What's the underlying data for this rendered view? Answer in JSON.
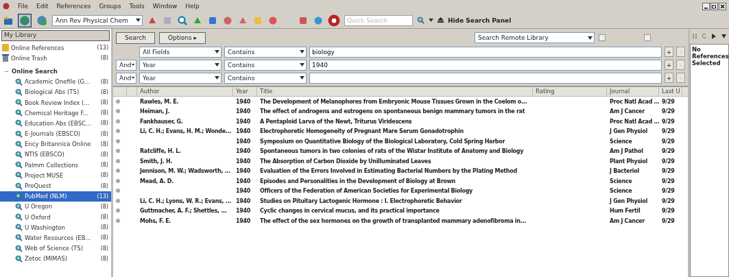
{
  "menu": [
    "File",
    "Edit",
    "References",
    "Groups",
    "Tools",
    "Window",
    "Help"
  ],
  "toolbar": {
    "style": "Ann Rev Physical Chem",
    "quick_search": {
      "placeholder": "Quick Search"
    },
    "hide_panel": "Hide Search Panel"
  },
  "sidebar": {
    "header": "My Library",
    "top_items": [
      {
        "kind": "references",
        "label": "Online References",
        "count": "(13)",
        "selected": false
      },
      {
        "kind": "trash",
        "label": "Online Trash",
        "count": "(8)",
        "selected": false
      }
    ],
    "group": {
      "toggle": "−",
      "label": "Online Search",
      "items": [
        {
          "label": "Academic Onefile (G...",
          "count": "(8)",
          "selected": false
        },
        {
          "label": "Biological Abs (TS)",
          "count": "(8)",
          "selected": false
        },
        {
          "label": "Book Review Index (...",
          "count": "(8)",
          "selected": false
        },
        {
          "label": "Chemical Heritage F...",
          "count": "(8)",
          "selected": false
        },
        {
          "label": "Education Abs (EBSC...",
          "count": "(8)",
          "selected": false
        },
        {
          "label": "E-Journals (EBSCO)",
          "count": "(8)",
          "selected": false
        },
        {
          "label": "Ency Britannica Online",
          "count": "(8)",
          "selected": false
        },
        {
          "label": "NTIS (EBSCO)",
          "count": "(8)",
          "selected": false
        },
        {
          "label": "Palmm Collections",
          "count": "(8)",
          "selected": false
        },
        {
          "label": "Project MUSE",
          "count": "(8)",
          "selected": false
        },
        {
          "label": "ProQuest",
          "count": "(8)",
          "selected": false
        },
        {
          "label": "PubMed (NLM)",
          "count": "(13)",
          "selected": true
        },
        {
          "label": "U Oregon",
          "count": "(8)",
          "selected": false
        },
        {
          "label": "U Oxford",
          "count": "(8)",
          "selected": false
        },
        {
          "label": "U Washington",
          "count": "(8)",
          "selected": false
        },
        {
          "label": "Water Resources (EB...",
          "count": "(8)",
          "selected": false
        },
        {
          "label": "Web of Science (TS)",
          "count": "(8)",
          "selected": false
        },
        {
          "label": "Zetoc (MIMAS)",
          "count": "(8)",
          "selected": false
        }
      ]
    }
  },
  "search_panel": {
    "search_button": "Search",
    "options_button": "Options ▸",
    "mode": "Search Remote Library",
    "remote_options": [
      {
        "checked": false
      },
      {
        "checked": false
      }
    ],
    "criteria": [
      {
        "field": "All Fields",
        "operator": "Contains",
        "value": "biology",
        "add": "+",
        "remove": "-"
      },
      {
        "connector": "And",
        "field": "Year",
        "operator": "Contains",
        "value": "1940",
        "add": "+",
        "remove": "-"
      },
      {
        "connector": "And",
        "field": "Year",
        "operator": "Contains",
        "add": "+",
        "remove": "-"
      }
    ]
  },
  "table": {
    "columns": [
      "Author",
      "Year",
      "Title",
      "Rating",
      "Journal",
      "Last U"
    ],
    "rows": [
      {
        "author": "Rawles, M. E.",
        "year": "1940",
        "title": "The Development of Melanophores from Embryonic Mouse Tissues Grown in the Coelom o...",
        "journal": "Proc Natl Acad ...",
        "last": "9/29"
      },
      {
        "author": "Heiman, J.",
        "year": "1940",
        "title": "The effect of androgens and estrogens on spontaneous benign mammary tumors in the rat",
        "journal": "Am J Cancer",
        "last": "9/29"
      },
      {
        "author": "Fankhauser, G.",
        "year": "1940",
        "title": "A Pentaploid Larva of the Newt, Triturus Viridescens",
        "journal": "Proc Natl Acad ...",
        "last": "9/29"
      },
      {
        "author": "Li, C. H.; Evans, H. M.; Wonde...",
        "year": "1940",
        "title": "Electrophoretic Homogeneity of Pregnant Mare Serum Gonadotrophin",
        "journal": "J Gen Physiol",
        "last": "9/29"
      },
      {
        "author": "",
        "year": "1940",
        "title": "Symposium on Quantitative Biology of the Biological Laboratory, Cold Spring Harbor",
        "journal": "Science",
        "last": "9/29"
      },
      {
        "author": "Ratcliffe, H. L.",
        "year": "1940",
        "title": "Spontaneous tumors in two colonies of rats of the Wistar Institute of Anatomy and Biology",
        "journal": "Am J Pathol",
        "last": "9/29"
      },
      {
        "author": "Smith, J. H.",
        "year": "1940",
        "title": "The Absorption of Carbon Dioxide by Unilluminated Leaves",
        "journal": "Plant Physiol",
        "last": "9/29"
      },
      {
        "author": "Jennison, M. W.; Wadsworth, ...",
        "year": "1940",
        "title": "Evaluation of the Errors Involved in Estimating Bacterial Numbers by the Plating Method",
        "journal": "J Bacteriol",
        "last": "9/29"
      },
      {
        "author": "Mead, A. D.",
        "year": "1940",
        "title": "Episodes and Personalities in the Development of Biology at Brown",
        "journal": "Science",
        "last": "9/29"
      },
      {
        "author": "",
        "year": "1940",
        "title": "Officers of the Federation of American Societies for Experimental Biology",
        "journal": "Science",
        "last": "9/29"
      },
      {
        "author": "Li, C. H.; Lyons, W. R.; Evans, ...",
        "year": "1940",
        "title": "Studies on Pituitary Lactogenic Hormone : I. Electrophoretic Behavior",
        "journal": "J Gen Physiol",
        "last": "9/29"
      },
      {
        "author": "Guttmacher, A. F.; Shettles, ...",
        "year": "1940",
        "title": "Cyclic changes in cervical mucus, and its practical importance",
        "journal": "Hum Fertil",
        "last": "9/29"
      },
      {
        "author": "Mohs, F. E.",
        "year": "1940",
        "title": "The effect of the sex hormones on the growth of transplanted mammary adenofibroma in...",
        "journal": "Am J Cancer",
        "last": "9/29"
      }
    ]
  },
  "preview": {
    "message": "No References Selected"
  }
}
